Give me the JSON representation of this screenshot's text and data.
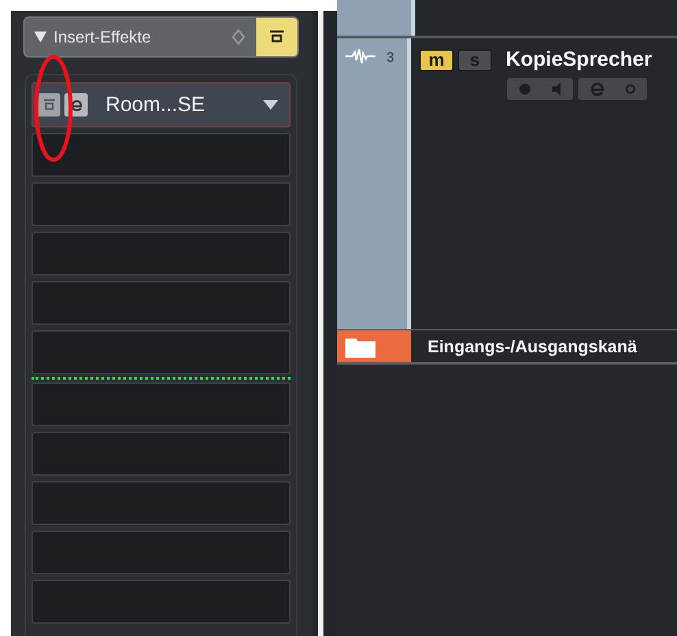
{
  "insert_panel": {
    "title": "Insert-Effekte",
    "panel_on": true,
    "slots": [
      {
        "kind": "plugin",
        "name": "Room...SE",
        "bypassed": false
      },
      {
        "kind": "empty"
      },
      {
        "kind": "empty"
      },
      {
        "kind": "empty"
      },
      {
        "kind": "empty"
      },
      {
        "kind": "empty"
      },
      {
        "kind": "fader-line"
      },
      {
        "kind": "empty"
      },
      {
        "kind": "empty"
      },
      {
        "kind": "empty"
      },
      {
        "kind": "empty"
      },
      {
        "kind": "empty"
      }
    ]
  },
  "annotation": {
    "kind": "ellipse",
    "color": "#e8141c"
  },
  "tracks": [
    {
      "kind": "audio",
      "number": "3",
      "name": "KopieSprecher",
      "mute_label": "m",
      "solo_label": "s",
      "mute": true,
      "solo": false
    }
  ],
  "folder": {
    "name": "Eingangs-/Ausgangskanä"
  }
}
